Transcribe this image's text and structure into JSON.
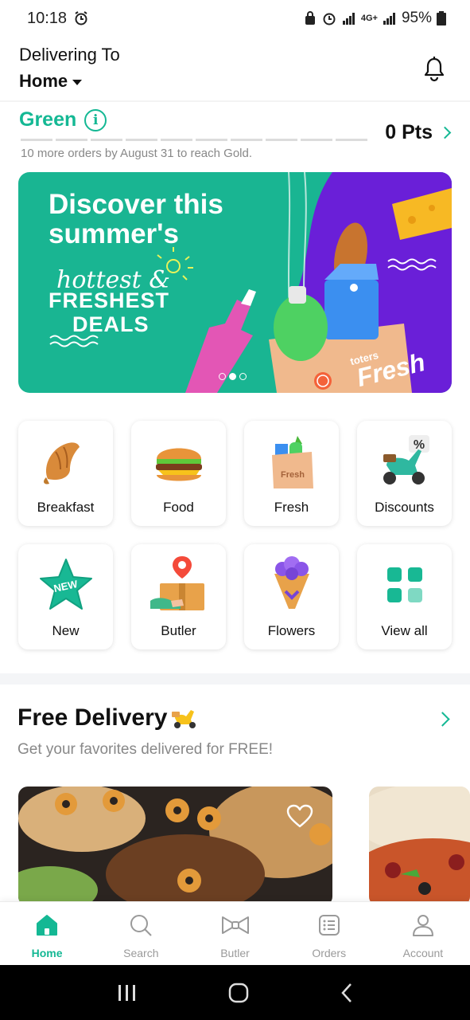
{
  "status_bar": {
    "time": "10:18",
    "battery": "95%",
    "network": "4G+"
  },
  "header": {
    "delivering_label": "Delivering To",
    "location": "Home"
  },
  "loyalty": {
    "tier": "Green",
    "note": "10 more orders by August 31 to reach Gold.",
    "points": "0 Pts",
    "progress_segments_filled": 0,
    "progress_segments_total": 10
  },
  "banner": {
    "title": "Discover this summer's",
    "script_text": "hottest &",
    "line1": "FRESHEST",
    "line2": "DEALS",
    "brand_small": "toters",
    "brand": "Fresh",
    "slides_total": 3,
    "slide_active": 2
  },
  "categories": [
    {
      "label": "Breakfast",
      "icon": "croissant-icon"
    },
    {
      "label": "Food",
      "icon": "burger-icon"
    },
    {
      "label": "Fresh",
      "icon": "grocery-bag-icon"
    },
    {
      "label": "Discounts",
      "icon": "scooter-discount-icon"
    },
    {
      "label": "New",
      "icon": "new-star-icon"
    },
    {
      "label": "Butler",
      "icon": "butler-package-icon"
    },
    {
      "label": "Flowers",
      "icon": "bouquet-icon"
    },
    {
      "label": "View all",
      "icon": "grid-icon"
    }
  ],
  "free_delivery": {
    "title": "Free Delivery",
    "subtitle": "Get your favorites delivered for FREE!"
  },
  "bottom_nav": [
    {
      "label": "Home",
      "icon": "home-icon",
      "active": true
    },
    {
      "label": "Search",
      "icon": "search-icon",
      "active": false
    },
    {
      "label": "Butler",
      "icon": "bowtie-icon",
      "active": false
    },
    {
      "label": "Orders",
      "icon": "orders-list-icon",
      "active": false
    },
    {
      "label": "Account",
      "icon": "user-icon",
      "active": false
    }
  ],
  "colors": {
    "brand_green": "#14b894",
    "banner_purple": "#6a1fd8"
  }
}
